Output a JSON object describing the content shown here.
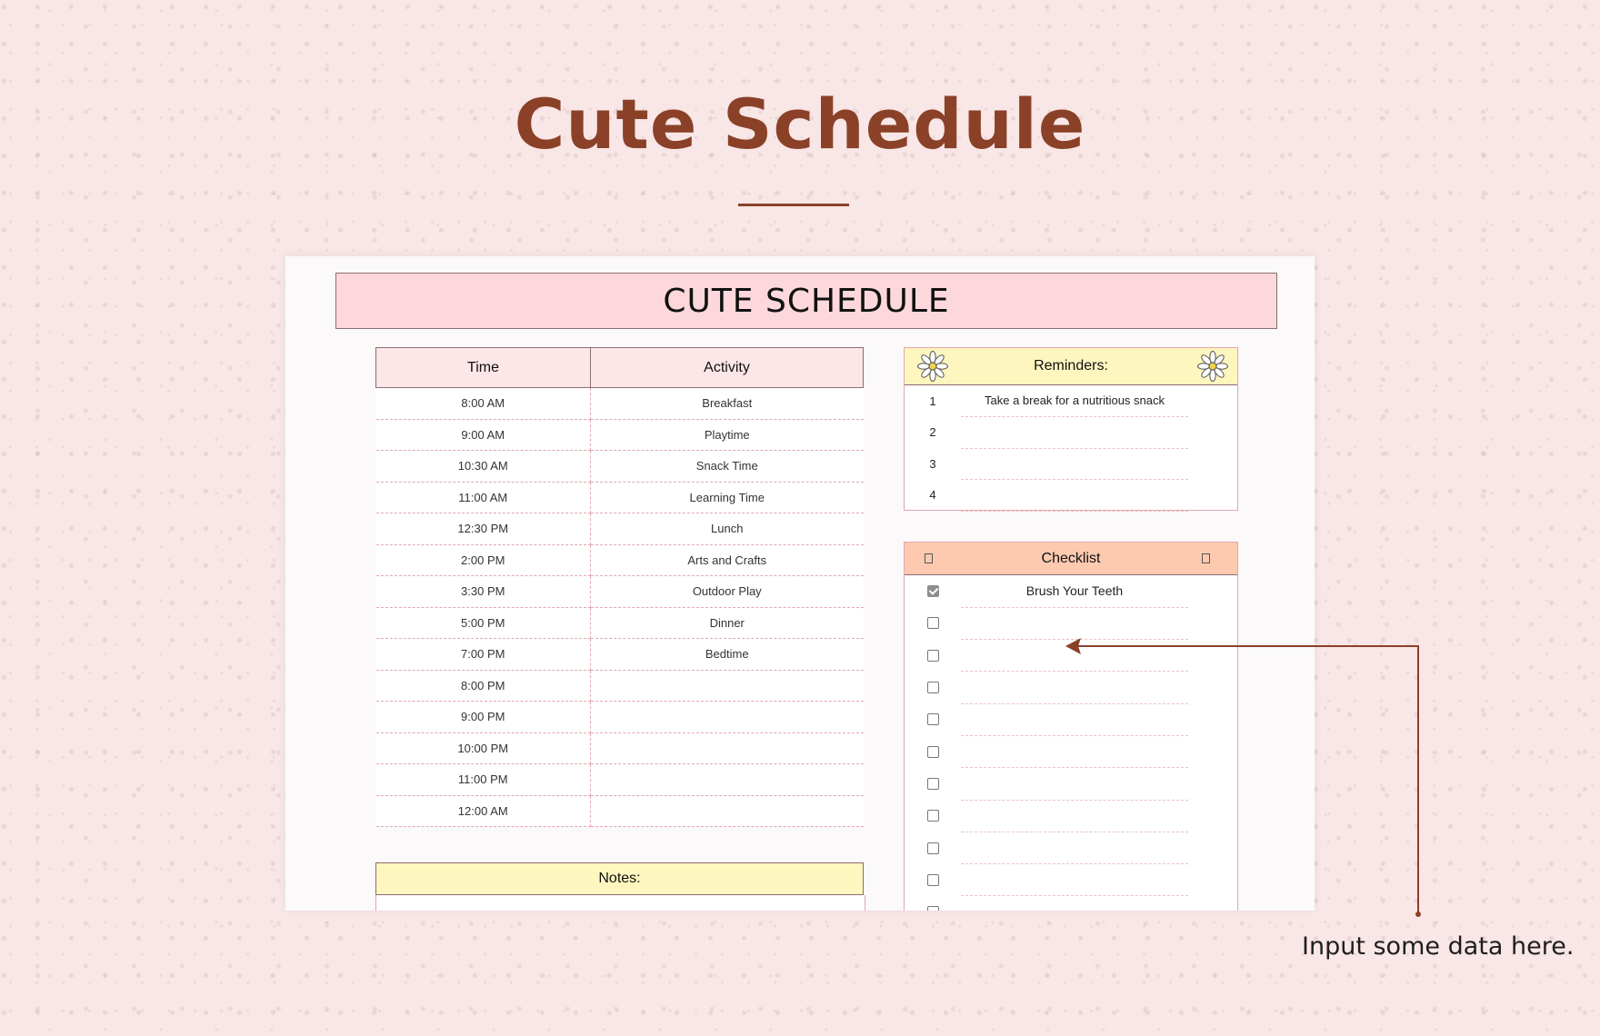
{
  "page": {
    "title": "Cute Schedule",
    "callout_text": "Input some data here."
  },
  "sheet": {
    "banner": "CUTE SCHEDULE",
    "schedule": {
      "headers": {
        "time": "Time",
        "activity": "Activity"
      },
      "rows": [
        {
          "time": "8:00 AM",
          "activity": "Breakfast"
        },
        {
          "time": "9:00 AM",
          "activity": "Playtime"
        },
        {
          "time": "10:30 AM",
          "activity": "Snack Time"
        },
        {
          "time": "11:00 AM",
          "activity": "Learning Time"
        },
        {
          "time": "12:30 PM",
          "activity": "Lunch"
        },
        {
          "time": "2:00 PM",
          "activity": "Arts and Crafts"
        },
        {
          "time": "3:30 PM",
          "activity": "Outdoor Play"
        },
        {
          "time": "5:00 PM",
          "activity": "Dinner"
        },
        {
          "time": "7:00 PM",
          "activity": "Bedtime"
        },
        {
          "time": "8:00 PM",
          "activity": ""
        },
        {
          "time": "9:00 PM",
          "activity": ""
        },
        {
          "time": "10:00 PM",
          "activity": ""
        },
        {
          "time": "11:00 PM",
          "activity": ""
        },
        {
          "time": "12:00 AM",
          "activity": ""
        }
      ]
    },
    "notes": {
      "title": "Notes:"
    },
    "reminders": {
      "title": "Reminders:",
      "icon": "daisy-icon",
      "items": [
        {
          "num": "1",
          "text": "Take a break for a nutritious snack"
        },
        {
          "num": "2",
          "text": ""
        },
        {
          "num": "3",
          "text": ""
        },
        {
          "num": "4",
          "text": ""
        }
      ]
    },
    "checklist": {
      "title": "Checklist",
      "items": [
        {
          "checked": true,
          "text": "Brush Your Teeth"
        },
        {
          "checked": false,
          "text": ""
        },
        {
          "checked": false,
          "text": ""
        },
        {
          "checked": false,
          "text": ""
        },
        {
          "checked": false,
          "text": ""
        },
        {
          "checked": false,
          "text": ""
        },
        {
          "checked": false,
          "text": ""
        },
        {
          "checked": false,
          "text": ""
        },
        {
          "checked": false,
          "text": ""
        },
        {
          "checked": false,
          "text": ""
        },
        {
          "checked": false,
          "text": ""
        }
      ]
    }
  },
  "colors": {
    "background": "#f9e6e6",
    "title_brown": "#8a4128",
    "banner_pink": "#fcd8dc",
    "header_yellow": "#fdf6bf",
    "header_peach": "#fdcab0",
    "callout_line": "#8a4128"
  }
}
